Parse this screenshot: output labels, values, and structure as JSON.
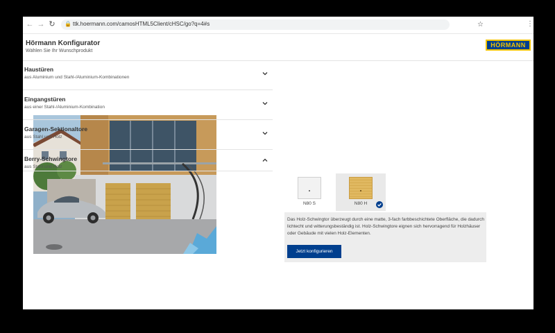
{
  "browser": {
    "url": "ttk.hoermann.com/camosHTML5Client/cHSC/go?q=4#s"
  },
  "header": {
    "title": "Hörmann Konfigurator",
    "subtitle": "Wählen Sie Ihr Wunschprodukt",
    "logo_text": "HÖRMANN",
    "brand_color": "#003f8e",
    "logo_accent": "#f3c300"
  },
  "accordion": [
    {
      "title": "Haustüren",
      "subtitle": "aus Aluminium und Stahl-/Aluminium-Kombinationen",
      "expanded": false
    },
    {
      "title": "Eingangstüren",
      "subtitle": "aus einer Stahl-/Aluminium-Kombination",
      "expanded": false
    },
    {
      "title": "Garagen-Sektionaltore",
      "subtitle": "aus Stahl und Holz",
      "expanded": false
    },
    {
      "title": "Berry-Schwingtore",
      "subtitle": "aus Stahl und Holz",
      "expanded": true
    }
  ],
  "products": [
    {
      "label": "N80 S",
      "selected": false
    },
    {
      "label": "N80 H",
      "selected": true
    }
  ],
  "description": "Das Holz-Schwingtor überzeugt durch eine matte, 3-fach farbbeschichtete Oberfläche, die dadurch lichtecht und witterungsbeständig ist. Holz-Schwingtore eignen sich hervorragend für Holzhäuser oder Gebäude mit vielen Holz-Elementen.",
  "cta_label": "Jetzt konfigurieren"
}
